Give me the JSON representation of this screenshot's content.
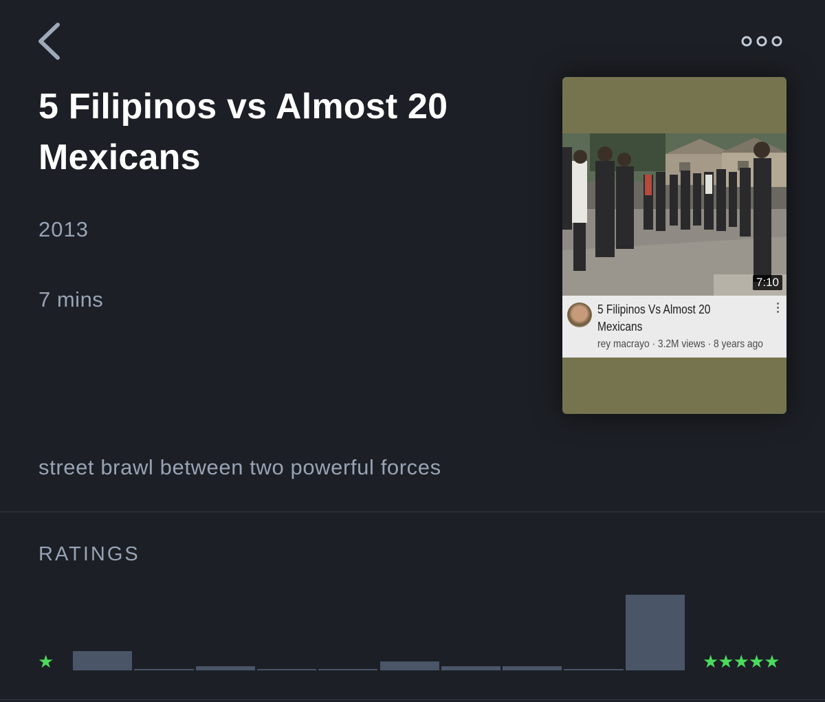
{
  "header": {
    "back_icon": "chevron-left-icon",
    "more_icon": "ellipsis-icon"
  },
  "film": {
    "title": "5 Filipinos vs Almost 20 Mexicans",
    "year": "2013",
    "duration": "7 mins",
    "tagline": "street brawl between two powerful forces"
  },
  "poster": {
    "video_duration": "7:10",
    "video_title": "5 Filipinos Vs Almost 20 Mexicans",
    "video_meta": "rey macrayo · 3.2M views · 8 years ago",
    "background_color": "#76744f"
  },
  "ratings": {
    "label": "RATINGS",
    "low_star": "★",
    "high_stars": "★★★★★",
    "star_color": "#4bdb5c",
    "bar_color": "#4a5568",
    "distribution": [
      0.25,
      0.02,
      0.05,
      0.02,
      0.02,
      0.12,
      0.05,
      0.05,
      0.02,
      1.0
    ]
  }
}
